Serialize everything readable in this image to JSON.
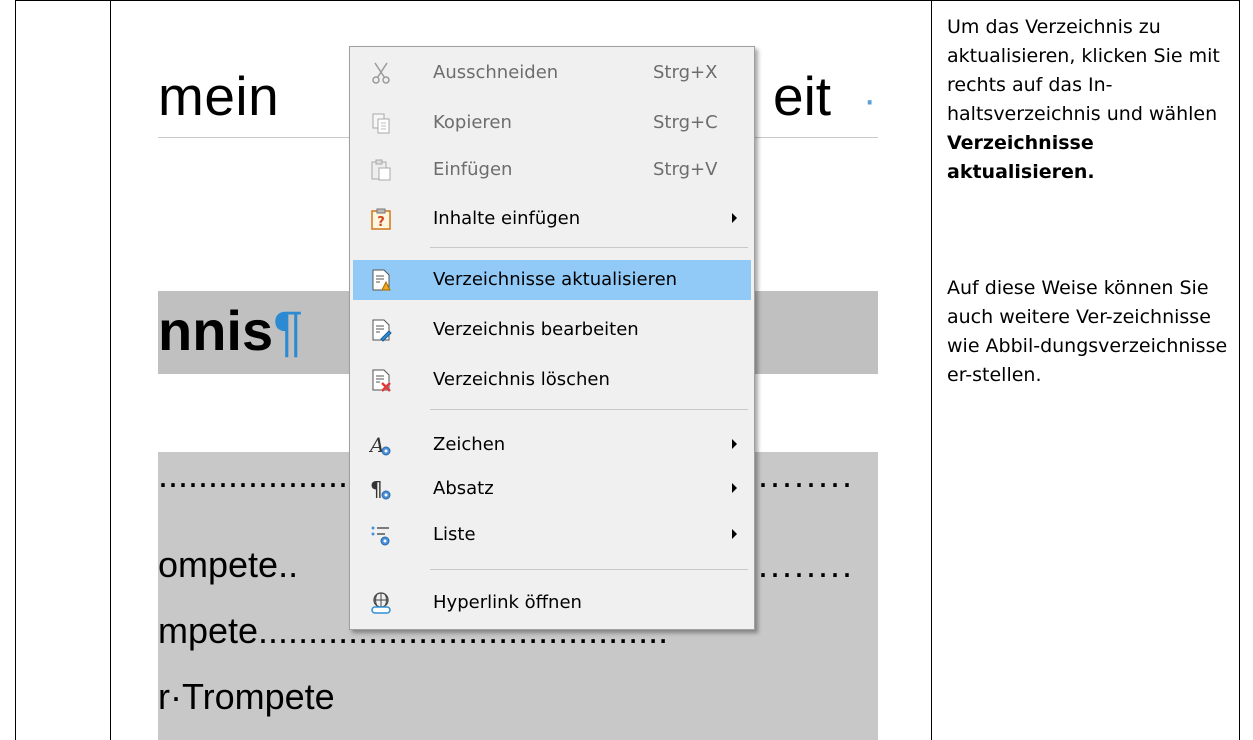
{
  "document": {
    "heading_fragment_left": "mein",
    "heading_fragment_right": "eit",
    "heading_dot": "·",
    "heading2_text": "nnis",
    "pilcrow": "¶",
    "toc_dots_top": "...................",
    "toc_dots_top_right": "........",
    "toc_line1": "ompete..",
    "toc_line1_right": "........",
    "toc_line2": "mpete.........................................",
    "toc_line3": "r·Trompete"
  },
  "context_menu": {
    "items": [
      {
        "icon": "scissors-icon",
        "label": "Ausschneiden",
        "shortcut": "Strg+X",
        "disabled": true
      },
      {
        "icon": "copy-icon",
        "label": "Kopieren",
        "shortcut": "Strg+C",
        "disabled": true
      },
      {
        "icon": "paste-icon",
        "label": "Einfügen",
        "shortcut": "Strg+V",
        "disabled": true
      },
      {
        "icon": "paste-special-icon",
        "label": "Inhalte einfügen",
        "submenu": true
      },
      {
        "icon": "update-index-icon",
        "label": "Verzeichnisse aktualisieren",
        "highlighted": true
      },
      {
        "icon": "edit-index-icon",
        "label": "Verzeichnis bearbeiten"
      },
      {
        "icon": "delete-index-icon",
        "label": "Verzeichnis löschen"
      },
      {
        "icon": "character-icon",
        "label": "Zeichen",
        "submenu": true
      },
      {
        "icon": "paragraph-icon",
        "label": "Absatz",
        "submenu": true
      },
      {
        "icon": "list-icon",
        "label": "Liste",
        "submenu": true
      },
      {
        "icon": "hyperlink-icon",
        "label": "Hyperlink öffnen"
      }
    ]
  },
  "instructions": {
    "para1_plain": "Um das Verzeichnis zu aktualisieren, klicken Sie mit rechts auf das In-haltsverzeichnis und wählen ",
    "para1_bold": "Verzeichnisse aktualisieren.",
    "para2": "Auf diese Weise können Sie auch weitere Ver-zeichnisse wie Abbil-dungsverzeichnisse er-stellen."
  },
  "colors": {
    "highlight": "#91c9f7",
    "menu_background": "#f0f0f0",
    "document_band": "#c0c0c0",
    "pilcrow": "#2b8ad1"
  }
}
